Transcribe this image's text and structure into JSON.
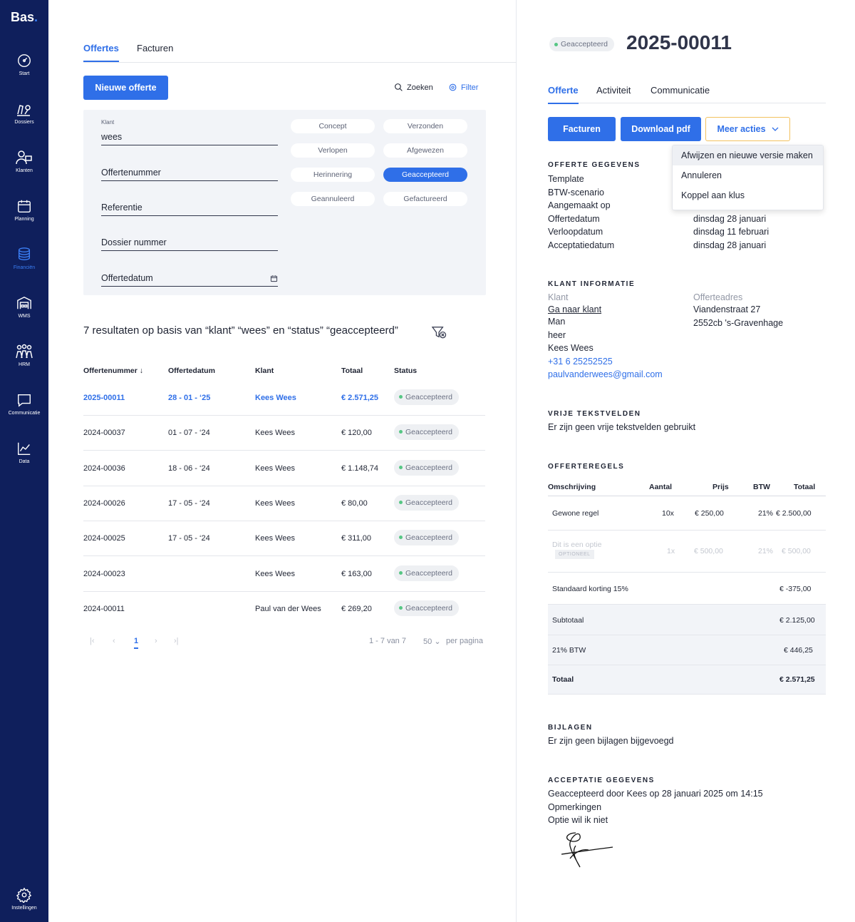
{
  "app": {
    "logo": "Bas",
    "logo_dot": "."
  },
  "sidebar": {
    "items": [
      {
        "label": "Start",
        "icon": "dashboard-icon"
      },
      {
        "label": "Dossiers",
        "icon": "dossiers-icon"
      },
      {
        "label": "Klanten",
        "icon": "customers-icon"
      },
      {
        "label": "Planning",
        "icon": "calendar-icon"
      },
      {
        "label": "Financiën",
        "icon": "coins-icon"
      },
      {
        "label": "WMS",
        "icon": "warehouse-icon"
      },
      {
        "label": "HRM",
        "icon": "team-icon"
      },
      {
        "label": "Communicatie",
        "icon": "chat-icon"
      },
      {
        "label": "Data",
        "icon": "chart-icon"
      }
    ],
    "settings_label": "Instellingen",
    "active": "Financiën",
    "active_color": "#3b7ff5"
  },
  "left": {
    "tabs": [
      "Offertes",
      "Facturen"
    ],
    "new_button": "Nieuwe offerte",
    "search_label": "Zoeken",
    "filter_label": "Filter",
    "filters": {
      "klant_label": "Klant",
      "klant_value": "wees",
      "offertenummer": "Offertenummer",
      "referentie": "Referentie",
      "dossier": "Dossier nummer",
      "offertedatum": "Offertedatum"
    },
    "chips": [
      "Concept",
      "Verzonden",
      "Verlopen",
      "Afgewezen",
      "Herinnering",
      "Geaccepteerd",
      "Geannuleerd",
      "Gefactureerd"
    ],
    "selected_chip": "Geaccepteerd",
    "result_text": "7 resultaten op basis van “klant” “wees” en “status” “geaccepteerd”",
    "columns": [
      "Offertenummer",
      "Offertedatum",
      "Klant",
      "Totaal",
      "Status"
    ],
    "rows": [
      {
        "nr": "2025-00011",
        "datum": "28 - 01 - ‘25",
        "klant": "Kees Wees",
        "totaal": "€ 2.571,25",
        "status": "Geaccepteerd"
      },
      {
        "nr": "2024-00037",
        "datum": "01 - 07 - ‘24",
        "klant": "Kees Wees",
        "totaal": "€ 120,00",
        "status": "Geaccepteerd"
      },
      {
        "nr": "2024-00036",
        "datum": "18 - 06 - ‘24",
        "klant": "Kees Wees",
        "totaal": "€ 1.148,74",
        "status": "Geaccepteerd"
      },
      {
        "nr": "2024-00026",
        "datum": "17 - 05 - ‘24",
        "klant": "Kees Wees",
        "totaal": "€ 80,00",
        "status": "Geaccepteerd"
      },
      {
        "nr": "2024-00025",
        "datum": "17 - 05 - ‘24",
        "klant": "Kees Wees",
        "totaal": "€ 311,00",
        "status": "Geaccepteerd"
      },
      {
        "nr": "2024-00023",
        "datum": "",
        "klant": "Kees Wees",
        "totaal": "€ 163,00",
        "status": "Geaccepteerd"
      },
      {
        "nr": "2024-00011",
        "datum": "",
        "klant": "Paul van der Wees",
        "totaal": "€ 269,20",
        "status": "Geaccepteerd"
      }
    ],
    "pager": {
      "current": "1",
      "range": "1 - 7 van 7",
      "per_page": "50",
      "per_page_label": "per pagina"
    }
  },
  "right": {
    "status": "Geaccepteerd",
    "title": "2025-00011",
    "tabs": [
      "Offerte",
      "Activiteit",
      "Communicatie"
    ],
    "buttons": {
      "invoice": "Facturen",
      "pdf": "Download pdf",
      "more": "Meer acties"
    },
    "dropdown": [
      "Afwijzen en nieuwe versie maken",
      "Annuleren",
      "Koppel aan klus"
    ],
    "offerte_gegevens": {
      "heading": "OFFERTE GEGEVENS",
      "labels": [
        "Template",
        "BTW-scenario",
        "Aangemaakt op",
        "Offertedatum",
        "Verloopdatum",
        "Acceptatiedatum"
      ],
      "values": [
        "dinsdag 28 januari",
        "dinsdag 11 februari",
        "dinsdag 28 januari"
      ]
    },
    "klant_informatie": {
      "heading": "KLANT INFORMATIE",
      "klant_label": "Klant",
      "link": "Ga naar klant",
      "lines": [
        "Man",
        "heer",
        "Kees Wees"
      ],
      "phone": "+31 6 25252525",
      "email": "paulvanderwees@gmail.com",
      "adres_label": "Offerteadres",
      "adres": [
        "Viandenstraat 27",
        "2552cb 's-Gravenhage"
      ]
    },
    "vrije": {
      "heading": "VRIJE TEKSTVELDEN",
      "text": "Er zijn geen vrije tekstvelden gebruikt"
    },
    "offerteregels": {
      "heading": "OFFERTEREGELS",
      "columns": [
        "Omschrijving",
        "Aantal",
        "Prijs",
        "BTW",
        "Totaal"
      ],
      "rows": [
        {
          "desc": "Gewone regel",
          "aantal": "10x",
          "prijs": "€ 250,00",
          "btw": "21%",
          "totaal": "€ 2.500,00"
        },
        {
          "desc": "Dit is een optie",
          "tag": "OPTIONEEL",
          "aantal": "1x",
          "prijs": "€ 500,00",
          "btw": "21%",
          "totaal": "€ 500,00"
        }
      ],
      "korting": {
        "label": "Standaard korting 15%",
        "value": "€ -375,00"
      },
      "subtotaal": {
        "label": "Subtotaal",
        "value": "€ 2.125,00"
      },
      "btw": {
        "label": "21% BTW",
        "value": "€ 446,25"
      },
      "totaal": {
        "label": "Totaal",
        "value": "€ 2.571,25"
      }
    },
    "bijlagen": {
      "heading": "BIJLAGEN",
      "text": "Er zijn geen bijlagen bijgevoegd"
    },
    "acceptatie": {
      "heading": "ACCEPTATIE GEGEVENS",
      "lines": [
        "Geaccepteerd door Kees op 28 januari 2025 om 14:15",
        "Opmerkingen",
        "Optie wil ik niet"
      ]
    }
  }
}
